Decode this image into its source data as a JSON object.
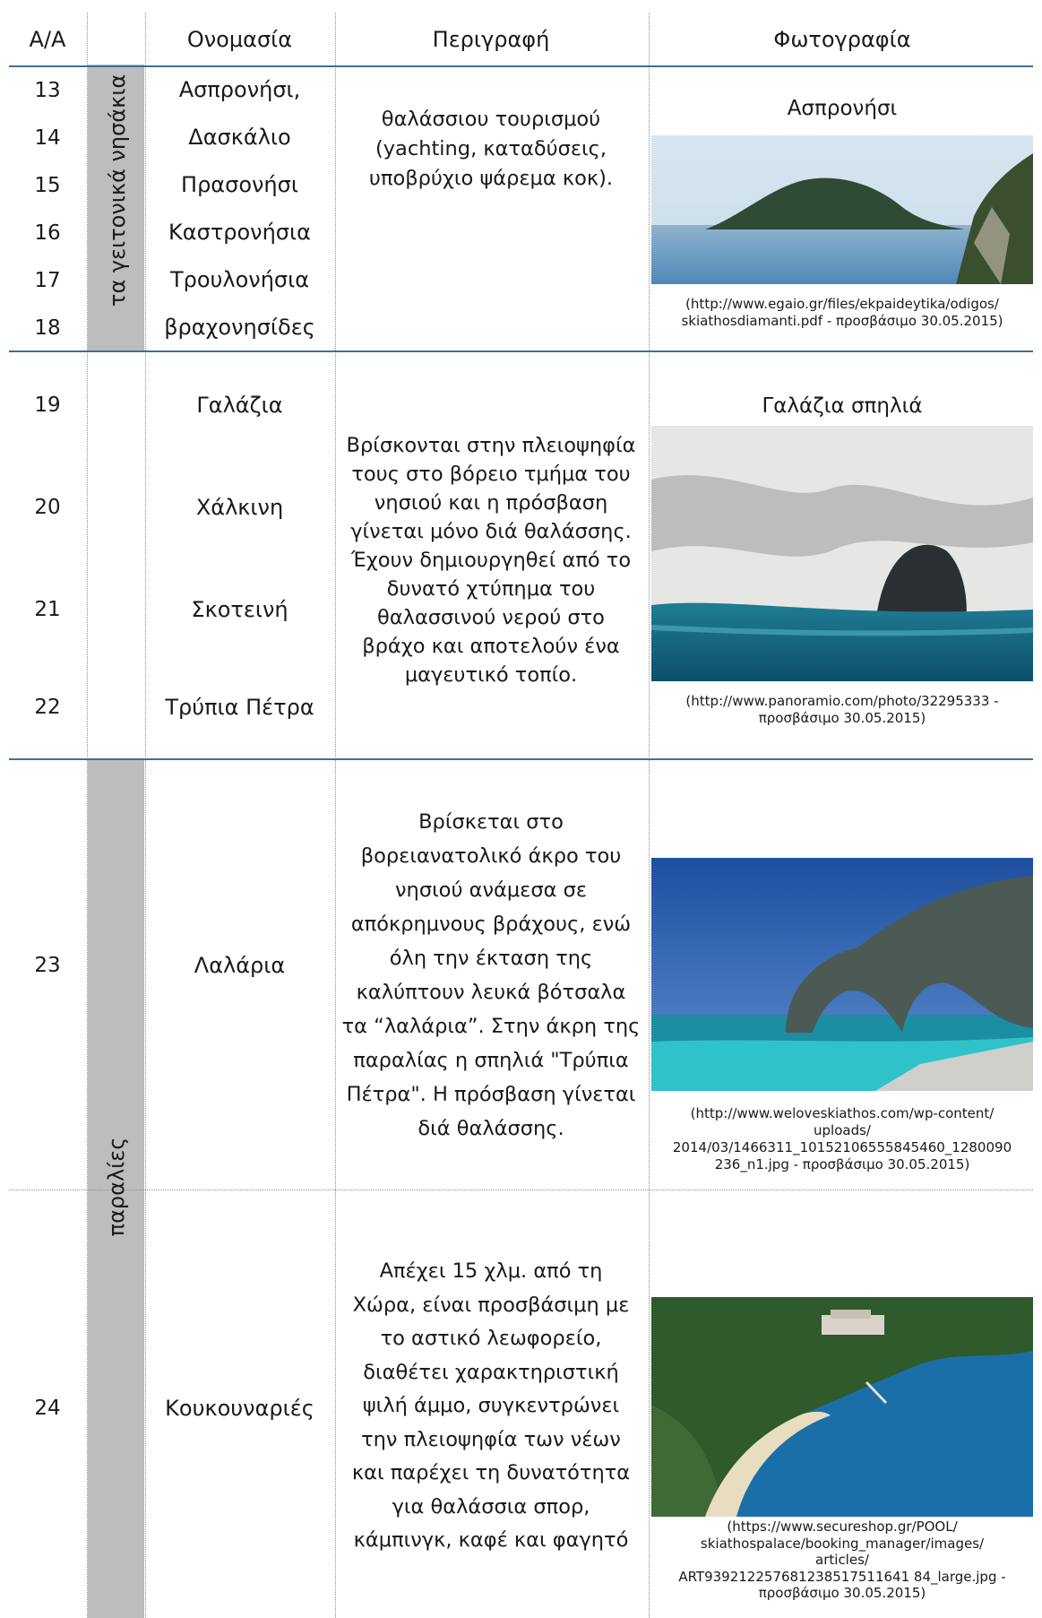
{
  "header": {
    "aa": "Α/Α",
    "name": "Ονομασία",
    "description": "Περιγραφή",
    "photo": "Φωτογραφία"
  },
  "groups": {
    "islets": "τα γειτονικά νησάκια",
    "beaches": "παραλίες"
  },
  "rows": {
    "r13": {
      "num": "13",
      "name": "Ασπρονήσι,"
    },
    "r14": {
      "num": "14",
      "name": "Δασκάλιο"
    },
    "r15": {
      "num": "15",
      "name": "Πρασονήσι"
    },
    "r16": {
      "num": "16",
      "name": "Καστρονήσια"
    },
    "r17": {
      "num": "17",
      "name": "Τρουλονήσια"
    },
    "r18": {
      "num": "18",
      "name": "βραχονησίδες"
    },
    "r19": {
      "num": "19",
      "name": "Γαλάζια"
    },
    "r20": {
      "num": "20",
      "name": "Χάλκινη"
    },
    "r21": {
      "num": "21",
      "name": "Σκοτεινή"
    },
    "r22": {
      "num": "22",
      "name": "Τρύπια Πέτρα"
    },
    "r23": {
      "num": "23",
      "name": "Λαλάρια"
    },
    "r24": {
      "num": "24",
      "name": "Κουκουναριές"
    }
  },
  "descriptions": {
    "islets": [
      "θαλάσσιου τουρισμού",
      "(yachting, καταδύσεις,",
      "υποβρύχιο ψάρεμα κοκ)."
    ],
    "caves": [
      "Βρίσκονται στην πλειοψηφία",
      "τους στο βόρειο τμήμα του",
      "νησιού και η πρόσβαση",
      "γίνεται μόνο διά θαλάσσης.",
      "Έχουν δημιουργηθεί από το",
      "δυνατό χτύπημα του",
      "θαλασσινού νερού στο",
      "βράχο και αποτελούν ένα",
      "μαγευτικό τοπίο."
    ],
    "lalaria": [
      "Βρίσκεται στο",
      "βορειανατολικό άκρο του",
      "νησιού ανάμεσα σε",
      "απόκρημνους βράχους, ενώ",
      "όλη την έκταση της",
      "καλύπτουν λευκά βότσαλα",
      "τα “λαλάρια”. Στην άκρη της",
      "παραλίας η σπηλιά \"Τρύπια",
      "Πέτρα\". Η πρόσβαση γίνεται",
      "διά θαλάσσης."
    ],
    "koukounaries": [
      "Απέχει 15 χλμ. από τη",
      "Χώρα,  είναι προσβάσιμη με",
      "το αστικό λεωφορείο,",
      "διαθέτει χαρακτηριστική",
      "ψιλή άμμο, συγκεντρώνει",
      "την πλειοψηφία των νέων",
      "και παρέχει τη δυνατότητα",
      "για θαλάσσια σπορ,",
      "κάμπινγκ, καφέ και φαγητό"
    ]
  },
  "photos": {
    "asproniso": {
      "title": "Ασπρονήσι",
      "caption": [
        "(http://www.egaio.gr/files/ekpaideytika/odigos/",
        "skiathosdiamanti.pdf - προσβάσιμο 30.05.2015)"
      ]
    },
    "galazia": {
      "title": "Γαλάζια σπηλιά",
      "caption": [
        "(http://www.panoramio.com/photo/32295333 -",
        "προσβάσιμο 30.05.2015)"
      ]
    },
    "lalaria": {
      "caption": [
        "(http://www.weloveskiathos.com/wp-content/",
        "uploads/",
        "2014/03/1466311_10152106555845460_1280090",
        "236_n1.jpg - προσβάσιμο 30.05.2015)"
      ]
    },
    "koukounaries": {
      "caption": [
        "(https://www.secureshop.gr/POOL/",
        "skiathospalace/booking_manager/images/",
        "articles/",
        "ART939212257681238517511641 84_large.jpg -",
        "προσβάσιμο 30.05.2015)"
      ]
    }
  }
}
